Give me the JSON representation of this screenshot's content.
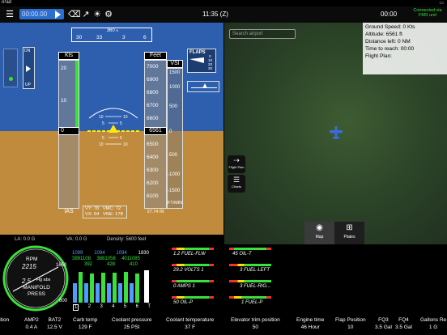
{
  "status": {
    "device": "iPad",
    "battery": "▭"
  },
  "toolbar": {
    "timer": "00:00.00",
    "clock": "11:35 (Z)",
    "timer_right": "00:00",
    "fms_line1": "Connected via",
    "fms_line2": "FMS unit"
  },
  "pfd": {
    "heading_value": "360",
    "heading_mark": "N",
    "heading_ticks": [
      "30",
      "33",
      "3",
      "6"
    ],
    "speed_label": "Kts",
    "speed_ticks": [
      "20",
      "10",
      "0"
    ],
    "speed_current": "0",
    "speed_unit": "IAS",
    "alt_label": "Feet",
    "alt_ticks": [
      "7000",
      "6900",
      "6800",
      "6700",
      "6600",
      "6500",
      "6400",
      "6300",
      "6200",
      "6100",
      "6000"
    ],
    "alt_current": "6561",
    "baro": "27.74 IN",
    "vsi_label": "VSI",
    "vsi_ticks": [
      "1500",
      "1000",
      "500",
      "0",
      "-500",
      "-1000",
      "-1500"
    ],
    "vsi_unit": "FT/MIN",
    "pitch_labels": [
      "10",
      "10",
      "5",
      "5",
      "5",
      "5",
      "10",
      "10"
    ],
    "vy": "VY: 78",
    "vmc": "VMC: 72",
    "vx": "VX: 64",
    "vne": "VNE: 178",
    "trim_dn": "DN",
    "trim_up": "UP",
    "flaps_label": "FLAPS",
    "flaps_values": [
      "0",
      "10",
      "20",
      "30"
    ],
    "la": "LA: 0.0 G",
    "va": "VA: 0.0 G",
    "density": "Density: 5600 feet"
  },
  "map": {
    "search_placeholder": "Search airport",
    "info": {
      "ground_speed": "Ground Speed: 0 Kts",
      "altitude": "Altitude: 6561 ft",
      "distance": "Distance left: 0 NM",
      "time": "Time to reach: 00:00",
      "plan": "Flight Plan:"
    },
    "btn_flight_plan": "Flight Plan",
    "btn_charts": "Charts",
    "tab_map": "Map",
    "tab_plates": "Plates"
  },
  "engine": {
    "rpm_label": "RPM",
    "rpm_value": "2215",
    "map_value": "2.5",
    "map_unit": "Hg abs",
    "manifold_line1": "MANIFOLD",
    "manifold_line2": "PRESS",
    "tick_1650": "1650",
    "tick_800": "800",
    "egt_row1": [
      "1099",
      "1094",
      "1094",
      "1830"
    ],
    "egt_row2": [
      "3991108",
      "3881058",
      "4011085"
    ],
    "egt_row3": [
      "392",
      "428",
      "410"
    ],
    "cyl_labels": [
      "1",
      "2",
      "3",
      "4",
      "5",
      "6",
      "T"
    ],
    "fuel_flow": "1.2 FUEL-FLW",
    "volts": "29.2 VOLTS 1",
    "amps": "0 AMPS 1",
    "oil_p": "50 OIL-P",
    "oil_t": "45 OIL-T",
    "fuel_left": "3 FUEL-LEFT",
    "fuel_right": "3 FUEL-RIG...",
    "fuel_p": "1 FUEL-P"
  },
  "strip": [
    {
      "label": "sition",
      "value": ""
    },
    {
      "label": "AMP2",
      "value": "0.4 A"
    },
    {
      "label": "BAT2",
      "value": "12.5 V"
    },
    {
      "label": "Carb temp",
      "value": "129 F"
    },
    {
      "label": "Coolant pressure",
      "value": "25 PSI"
    },
    {
      "label": "Coolant temperature",
      "value": "37 F"
    },
    {
      "label": "Elevator trim position",
      "value": "50"
    },
    {
      "label": "Engine time",
      "value": "46 Hour"
    },
    {
      "label": "Flap Position",
      "value": "10"
    },
    {
      "label": "FQ3",
      "value": "3.5 Gal"
    },
    {
      "label": "FQ4",
      "value": "3.5 Gal"
    },
    {
      "label": "Gallons Re",
      "value": "1 G"
    }
  ],
  "colors": {
    "sky": "#2d5fae",
    "ground": "#c08b3c",
    "accent": "#2a6fd0",
    "ok": "#3be03b"
  }
}
